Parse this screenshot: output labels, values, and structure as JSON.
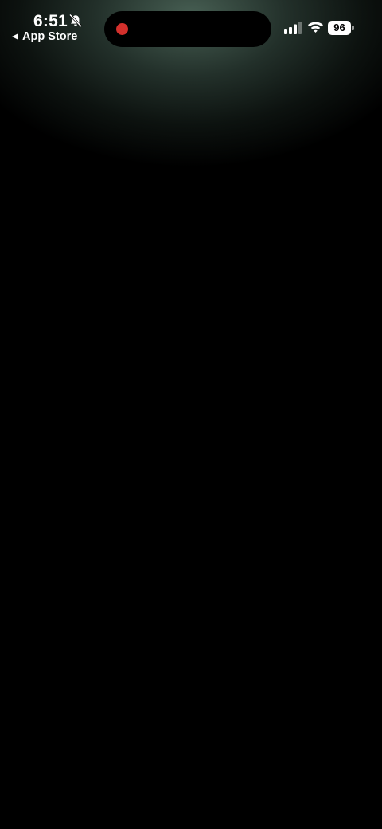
{
  "status_bar": {
    "time": "6:51",
    "silent_icon": "bell-slash-icon",
    "back_label": "App Store",
    "battery_level": "96",
    "signal_bars_active": 3,
    "signal_bars_total": 4,
    "recording_indicator_color": "#d3302c"
  },
  "theme": {
    "background": "#000000",
    "glow_color": "#4f6b5e",
    "text_color": "#ffffff"
  }
}
